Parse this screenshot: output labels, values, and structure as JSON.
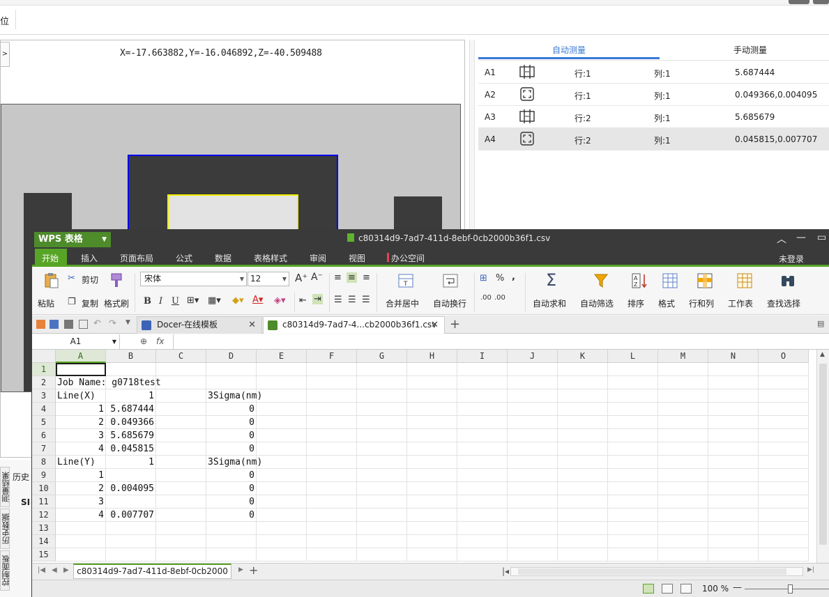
{
  "bg": {
    "toolbar_label": "位",
    "expand_label": ">",
    "coords": "X=-17.663882,Y=-16.046892,Z=-40.509488",
    "measure_tabs": [
      "自动测量",
      "手动测量"
    ],
    "measure_rows": [
      {
        "id": "A1",
        "icon": "line-width-icon",
        "row": "行:1",
        "col": "列:1",
        "value": "5.687444"
      },
      {
        "id": "A2",
        "icon": "box-frame-icon",
        "row": "行:1",
        "col": "列:1",
        "value": "0.049366,0.004095"
      },
      {
        "id": "A3",
        "icon": "line-width-icon",
        "row": "行:2",
        "col": "列:1",
        "value": "5.685679"
      },
      {
        "id": "A4",
        "icon": "box-frame-icon",
        "row": "行:2",
        "col": "列:1",
        "value": "0.045815,0.007707"
      }
    ],
    "vertical_tabs": [
      "测量结果",
      "历史数据",
      "控制面板"
    ],
    "bottom_stub_1": "历史",
    "bottom_stub_2": "SI"
  },
  "wps": {
    "app_name": "WPS 表格",
    "doc_title": "c80314d9-7ad7-411d-8ebf-0cb2000b36f1.csv",
    "menu": [
      "开始",
      "插入",
      "页面布局",
      "公式",
      "数据",
      "表格样式",
      "审阅",
      "视图",
      "办公空间"
    ],
    "login": "未登录",
    "ribbon": {
      "paste": "粘贴",
      "cut": "剪切",
      "copy": "复制",
      "format_painter": "格式刷",
      "font_name": "宋体",
      "font_size": "12",
      "merge_center": "合并居中",
      "wrap_text": "自动换行",
      "autosum": "自动求和",
      "auto_filter": "自动筛选",
      "sort": "排序",
      "format": "格式",
      "row_col": "行和列",
      "worksheet": "工作表",
      "find_select": "查找选择"
    },
    "tabs": [
      {
        "label": "Docer-在线模板"
      },
      {
        "label": "c80314d9-7ad7-4...cb2000b36f1.csv"
      }
    ],
    "name_box": "A1",
    "fx_label": "fx",
    "columns": [
      "A",
      "B",
      "C",
      "D",
      "E",
      "F",
      "G",
      "H",
      "I",
      "J",
      "K",
      "L",
      "M",
      "N",
      "O"
    ],
    "rows": [
      "1",
      "2",
      "3",
      "4",
      "5",
      "6",
      "7",
      "8",
      "9",
      "10",
      "11",
      "12",
      "13",
      "14",
      "15"
    ],
    "cells": {
      "A2": "Job Name: g0718test",
      "A3": "Line(X)",
      "B3": "1",
      "D3": "3Sigma(nm)",
      "A4": "1",
      "B4": "5.687444",
      "D4": "0",
      "A5": "2",
      "B5": "0.049366",
      "D5": "0",
      "A6": "3",
      "B6": "5.685679",
      "D6": "0",
      "A7": "4",
      "B7": "0.045815",
      "D7": "0",
      "A8": "Line(Y)",
      "B8": "1",
      "D8": "3Sigma(nm)",
      "A9": "1",
      "D9": "0",
      "A10": "2",
      "B10": "0.004095",
      "D10": "0",
      "A11": "3",
      "D11": "0",
      "A12": "4",
      "B12": "0.007707",
      "D12": "0"
    },
    "sheet_tab": "c80314d9-7ad7-411d-8ebf-0cb2000",
    "zoom": "100 %"
  }
}
